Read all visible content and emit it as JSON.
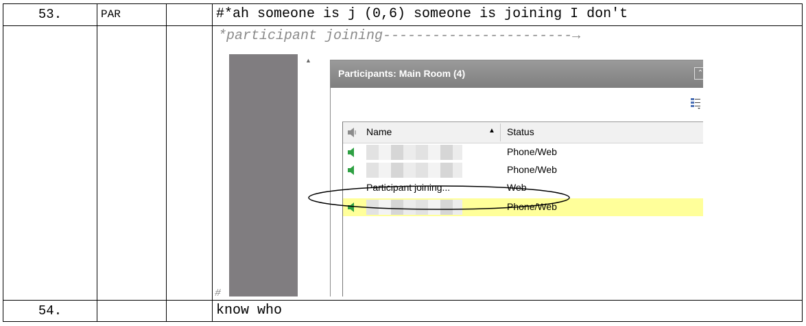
{
  "rows": [
    {
      "number": "53.",
      "speaker": "PAR",
      "text": "#*ah someone is j (0,6) someone is joining I don't"
    },
    {
      "number": "",
      "speaker": "",
      "annotation": "*participant joining-----------------------→",
      "end_marker": "#"
    },
    {
      "number": "54.",
      "speaker": "",
      "text": "know who"
    }
  ],
  "screenshot": {
    "panel_title": "Participants: Main Room (4)",
    "columns": {
      "name": "Name",
      "status": "Status"
    },
    "sort_indicator": "▲",
    "participants": [
      {
        "name": "",
        "status": "Phone/Web",
        "speaker_icon": true,
        "blurred": true,
        "highlighted": false
      },
      {
        "name": "",
        "status": "Phone/Web",
        "speaker_icon": true,
        "blurred": true,
        "highlighted": false
      },
      {
        "name": "Participant joining...",
        "status": "Web",
        "speaker_icon": false,
        "blurred": false,
        "highlighted": false
      },
      {
        "name": "",
        "status": "Phone/Web",
        "speaker_icon": true,
        "blurred": true,
        "highlighted": true
      }
    ],
    "colors": {
      "speaker_green": "#2ea043",
      "highlight": "#ffff9a",
      "title_bar": "#8a8a8a"
    }
  }
}
